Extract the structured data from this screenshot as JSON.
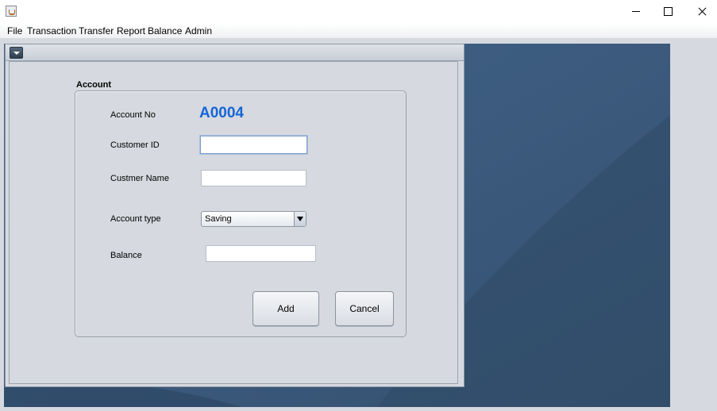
{
  "window": {
    "icon": "java-cup-icon",
    "controls": [
      "minimize-icon",
      "maximize-icon",
      "close-icon"
    ]
  },
  "menubar": {
    "items": [
      "File",
      "Transaction",
      "Transfer",
      "Report",
      "Balance",
      "Admin"
    ]
  },
  "internal_frame": {
    "menu_icon": "chevron-down-icon"
  },
  "account_form": {
    "title": "Account",
    "account_no_label": "Account No",
    "account_no_value": "A0004",
    "customer_id_label": "Customer ID",
    "customer_id_value": "",
    "customer_name_label": "Custmer Name",
    "customer_name_value": "",
    "account_type_label": "Account type",
    "account_type_value": "Saving",
    "balance_label": "Balance",
    "balance_value": "",
    "add_label": "Add",
    "cancel_label": "Cancel"
  },
  "colors": {
    "accent": "#1565d8",
    "desktop": "#3a5878"
  }
}
